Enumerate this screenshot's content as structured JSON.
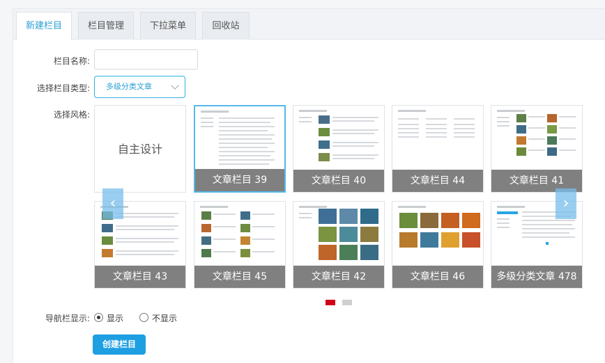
{
  "tabs": [
    {
      "label": "新建栏目",
      "active": true
    },
    {
      "label": "栏目管理",
      "active": false
    },
    {
      "label": "下拉菜单",
      "active": false
    },
    {
      "label": "回收站",
      "active": false
    }
  ],
  "form": {
    "name_label": "栏目名称:",
    "name_value": "",
    "type_label": "选择栏目类型:",
    "type_value": "多级分类文章",
    "style_label": "选择风格:",
    "nav_label": "导航栏显示:",
    "nav_options": [
      {
        "label": "显示",
        "checked": true
      },
      {
        "label": "不显示",
        "checked": false
      }
    ],
    "create_button": "创建栏目"
  },
  "styles": [
    {
      "label": "自主设计",
      "kind": "custom",
      "selected": false
    },
    {
      "label": "文章栏目 39",
      "kind": "list",
      "selected": true
    },
    {
      "label": "文章栏目 40",
      "kind": "imglist",
      "selected": false
    },
    {
      "label": "文章栏目 44",
      "kind": "table",
      "selected": false
    },
    {
      "label": "文章栏目 41",
      "kind": "sidegrid",
      "selected": false
    },
    {
      "label": "文章栏目 43",
      "kind": "imglist",
      "selected": false
    },
    {
      "label": "文章栏目 45",
      "kind": "twocol",
      "selected": false
    },
    {
      "label": "文章栏目 42",
      "kind": "photogrid",
      "selected": false
    },
    {
      "label": "文章栏目 46",
      "kind": "photogrid2",
      "selected": false
    },
    {
      "label": "多级分类文章 478",
      "kind": "sidelist",
      "selected": false
    }
  ],
  "carousel": {
    "prev_icon": "‹",
    "next_icon": "›",
    "active_dot_color": "#d0021b",
    "inactive_dot_color": "#cfcfcf"
  },
  "colors": {
    "accent": "#1e9fe2",
    "tab_active_text": "#2a9fd6"
  }
}
